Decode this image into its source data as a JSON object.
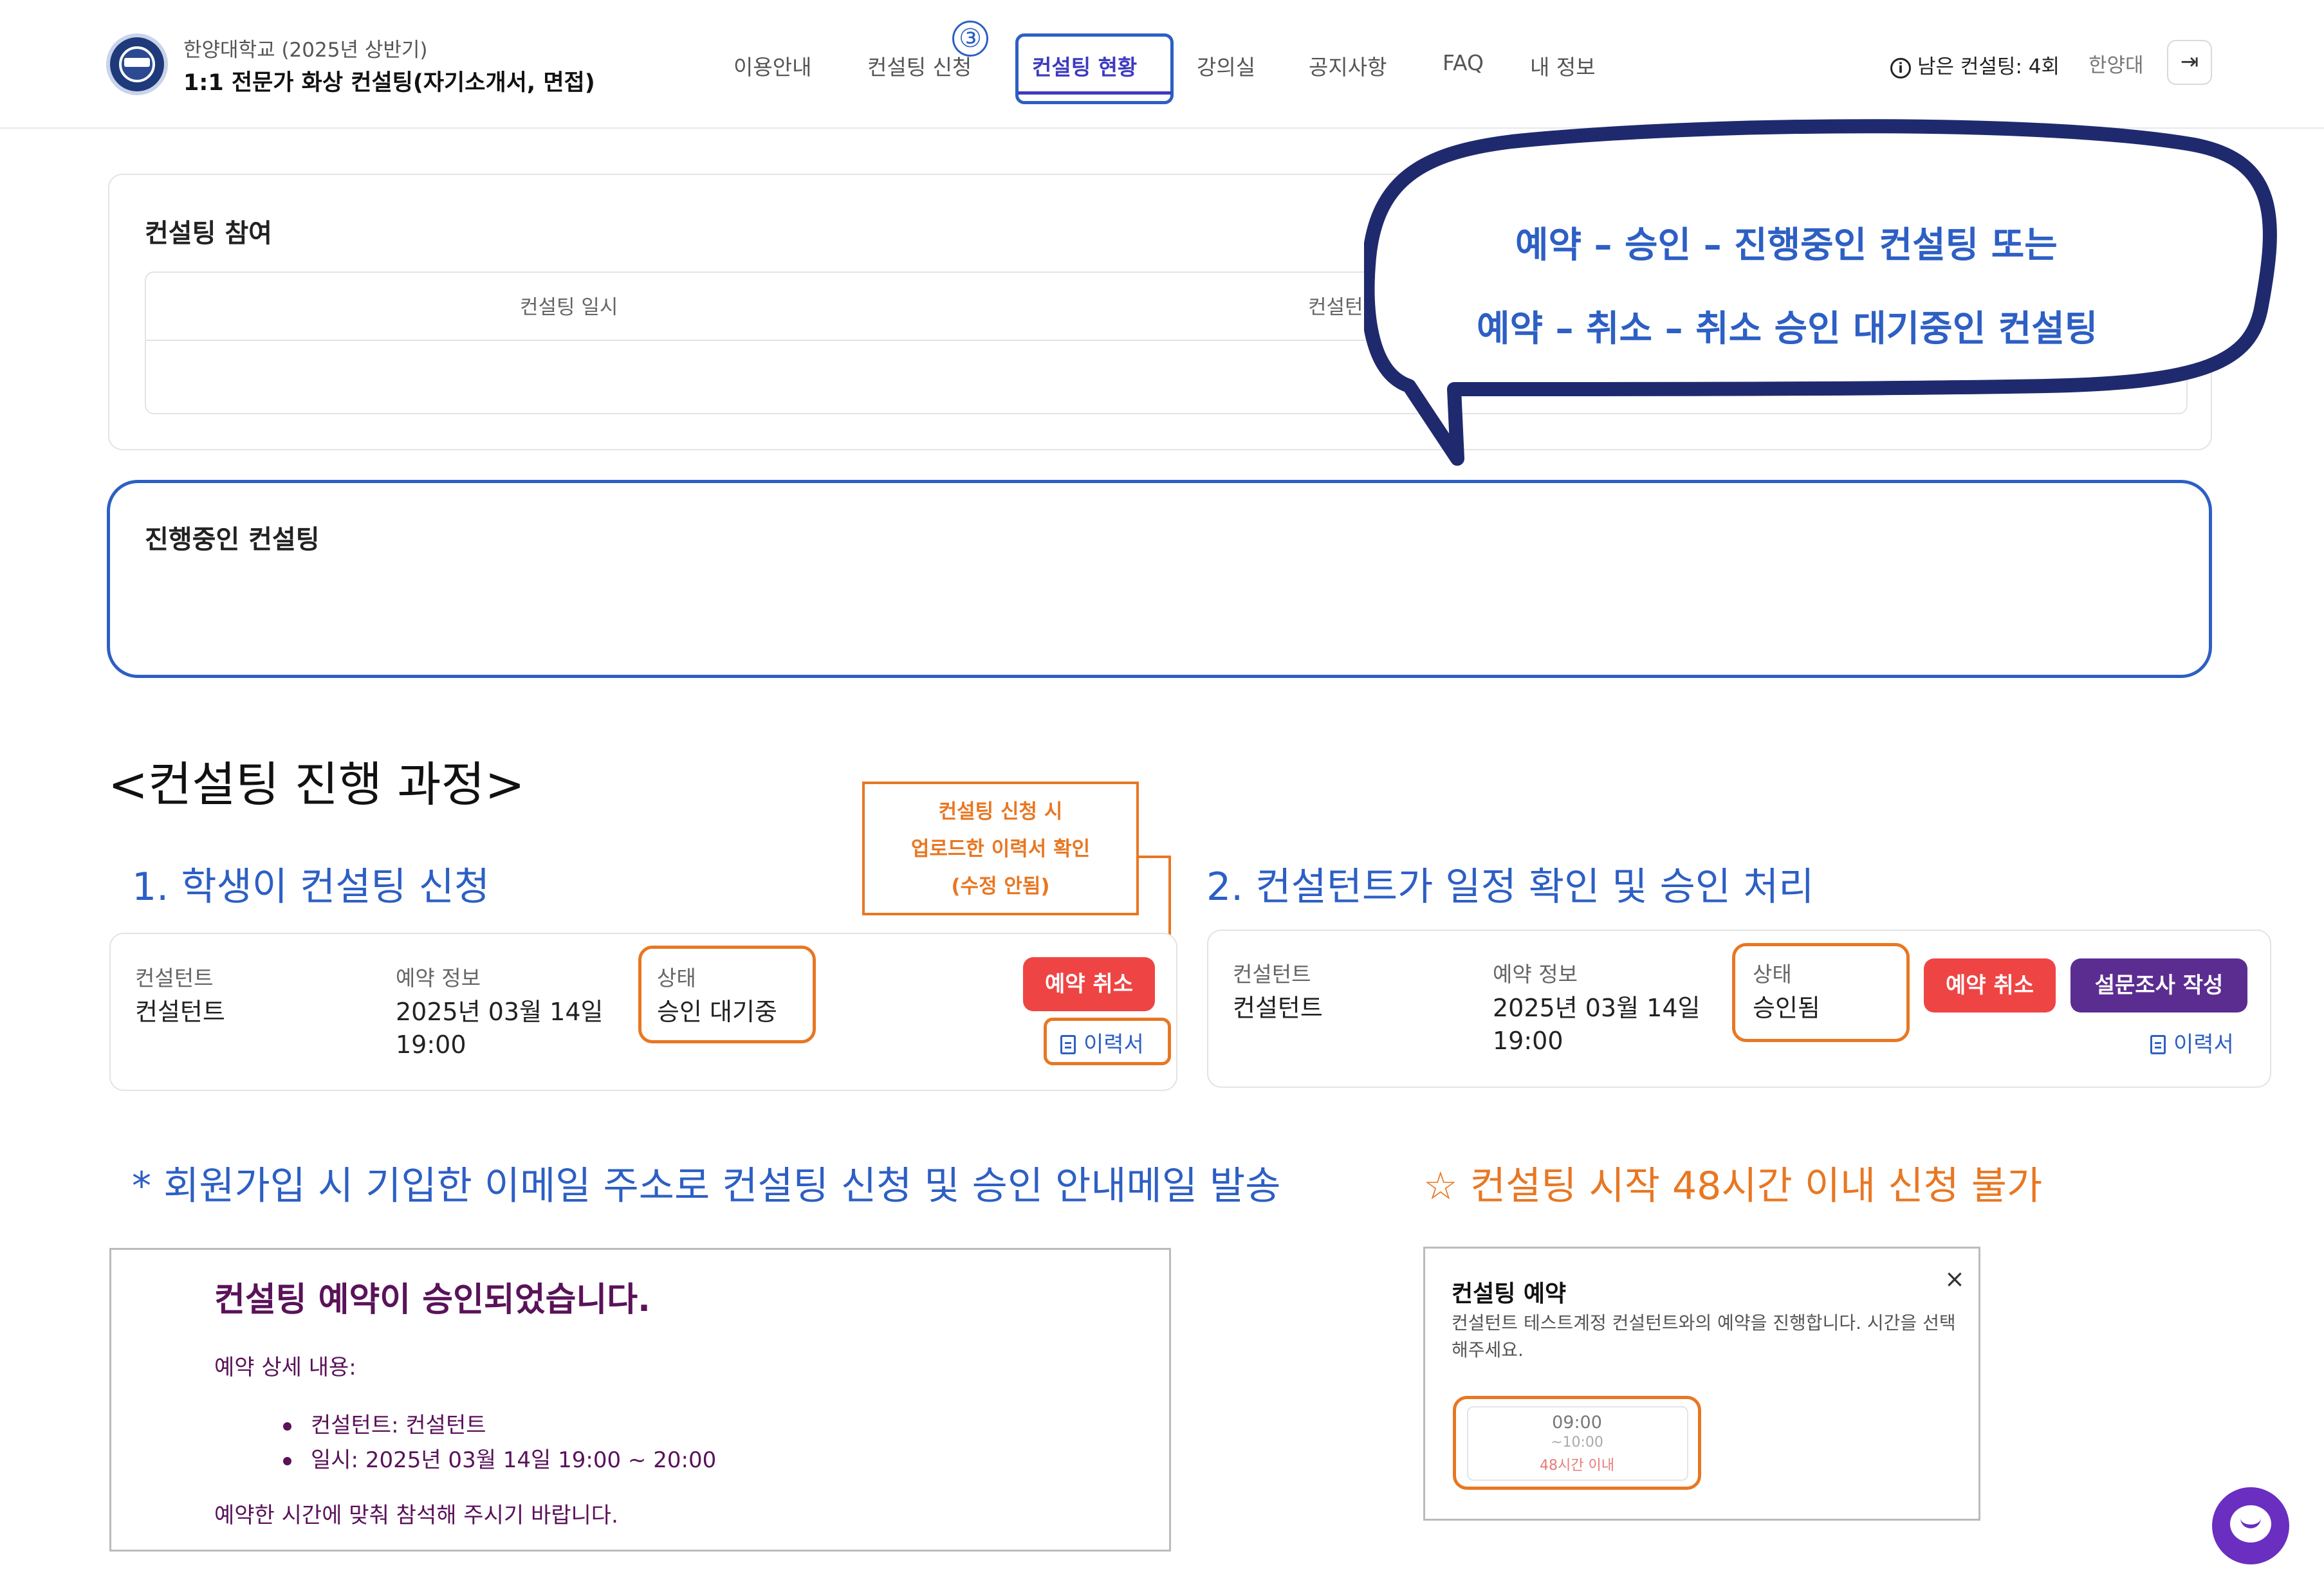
{
  "header": {
    "university": "한양대학교 (2025년 상반기)",
    "course_title": "1:1 전문가 화상 컨설팅(자기소개서, 면접)",
    "nav": [
      "이용안내",
      "컨설팅 신청",
      "컨설팅 현황",
      "강의실",
      "공지사항",
      "FAQ",
      "내 정보"
    ],
    "active_nav": "컨설팅 현황",
    "step_badge": "③",
    "remaining_label": "남은 컨설팅: 4회",
    "user_name": "한양대",
    "logout_icon": "logout-icon"
  },
  "participation": {
    "title": "컨설팅 참여",
    "columns": [
      "컨설팅 일시",
      "컨설턴"
    ]
  },
  "ongoing": {
    "title": "진행중인 컨설팅"
  },
  "bubble": {
    "line1": "예약 – 승인 – 진행중인 컨설팅 또는",
    "line2": "예약 – 취소 – 취소 승인 대기중인 컨설팅"
  },
  "process": {
    "title": "<컨설팅 진행 과정>",
    "step1": "1. 학생이 컨설팅 신청",
    "step2": "2. 컨설턴트가 일정 확인 및 승인 처리",
    "callout": [
      "컨설팅 신청 시",
      "업로드한 이력서 확인",
      "(수정 안됨)"
    ],
    "card1": {
      "consultant_label": "컨설턴트",
      "consultant_value": "컨설턴트",
      "info_label": "예약 정보",
      "date": "2025년 03월 14일",
      "time": "19:00",
      "status_label": "상태",
      "status_value": "승인 대기중",
      "cancel_button": "예약 취소",
      "resume_link": "이력서"
    },
    "card2": {
      "consultant_label": "컨설턴트",
      "consultant_value": "컨설턴트",
      "info_label": "예약 정보",
      "date": "2025년 03월 14일",
      "time": "19:00",
      "status_label": "상태",
      "status_value": "승인됨",
      "cancel_button": "예약 취소",
      "survey_button": "설문조사 작성",
      "resume_link": "이력서"
    }
  },
  "notes": {
    "email_note": "* 회원가입 시 기입한 이메일 주소로 컨설팅 신청 및 승인 안내메일 발송",
    "restriction_note": "☆ 컨설팅 시작 48시간 이내 신청 불가"
  },
  "email": {
    "title": "컨설팅 예약이 승인되었습니다.",
    "subtitle": "예약 상세 내용:",
    "items": [
      "컨설턴트: 컨설턴트",
      "일시: 2025년 03월 14일 19:00 ~ 20:00"
    ],
    "footer": "예약한 시간에 맞춰 참석해 주시기 바랍니다."
  },
  "modal": {
    "title": "컨설팅 예약",
    "close": "×",
    "description": "컨설턴트 테스트계정 컨설턴트와의 예약을 진행합니다. 시간을 선택해주세요.",
    "slot_time": "09:00",
    "slot_end": "~10:00",
    "slot_warning": "48시간 이내"
  },
  "colors": {
    "accent_blue": "#2d5fc4",
    "accent_orange": "#e87722",
    "danger_red": "#ef4444",
    "purple": "#5b2d90",
    "email_purple": "#5a1259",
    "chat_purple": "#6a2ec0"
  }
}
